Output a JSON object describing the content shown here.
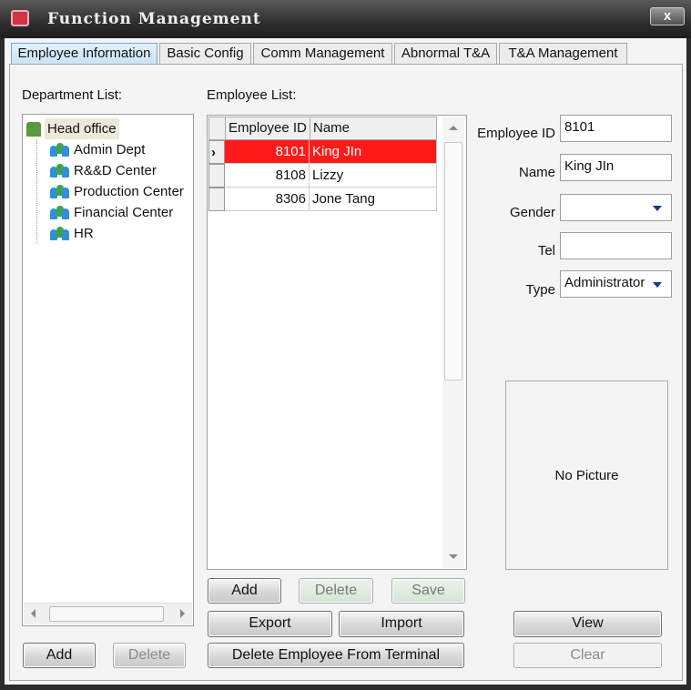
{
  "window": {
    "title": "Function Management",
    "close": "x"
  },
  "tabs": [
    {
      "label": "Employee Information",
      "active": true
    },
    {
      "label": "Basic Config"
    },
    {
      "label": "Comm Management"
    },
    {
      "label": "Abnormal T&A"
    },
    {
      "label": "T&A Management"
    }
  ],
  "department": {
    "label": "Department List:",
    "root": "Head office",
    "items": [
      "Admin Dept",
      "R&&D Center",
      "Production Center",
      "Financial Center",
      "HR"
    ],
    "add": "Add",
    "delete": "Delete"
  },
  "employees": {
    "label": "Employee List:",
    "columns": [
      "Employee ID",
      "Name"
    ],
    "rows": [
      {
        "id": "8101",
        "name": "King JIn",
        "selected": true
      },
      {
        "id": "8108",
        "name": "Lizzy"
      },
      {
        "id": "8306",
        "name": "Jone Tang"
      }
    ],
    "selected_color": "#ff1a1a",
    "add": "Add",
    "delete": "Delete",
    "save": "Save",
    "export": "Export",
    "import": "Import",
    "delete_terminal": "Delete Employee From Terminal"
  },
  "form": {
    "id_label": "Employee ID",
    "id": "8101",
    "name_label": "Name",
    "name": "King JIn",
    "gender_label": "Gender",
    "gender": "",
    "tel_label": "Tel",
    "tel": "",
    "type_label": "Type",
    "type": "Administrator",
    "picture": "No Picture",
    "view": "View",
    "clear": "Clear"
  }
}
